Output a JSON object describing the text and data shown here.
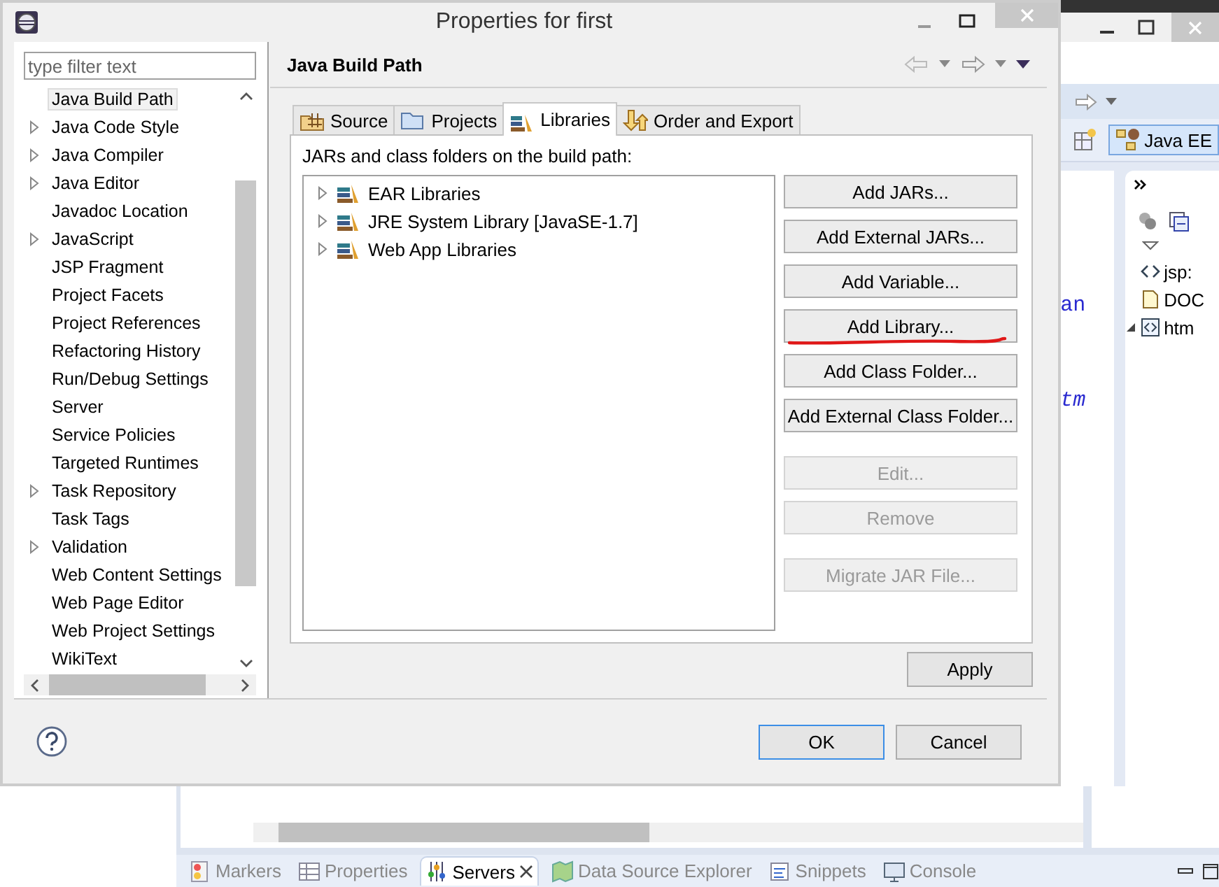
{
  "dialog": {
    "title": "Properties for first",
    "filter": {
      "placeholder": "type filter text"
    },
    "nav": [
      {
        "label": "Java Build Path",
        "expandable": false,
        "selected": true
      },
      {
        "label": "Java Code Style",
        "expandable": true,
        "selected": false
      },
      {
        "label": "Java Compiler",
        "expandable": true,
        "selected": false
      },
      {
        "label": "Java Editor",
        "expandable": true,
        "selected": false
      },
      {
        "label": "Javadoc Location",
        "expandable": false,
        "selected": false
      },
      {
        "label": "JavaScript",
        "expandable": true,
        "selected": false
      },
      {
        "label": "JSP Fragment",
        "expandable": false,
        "selected": false
      },
      {
        "label": "Project Facets",
        "expandable": false,
        "selected": false
      },
      {
        "label": "Project References",
        "expandable": false,
        "selected": false
      },
      {
        "label": "Refactoring History",
        "expandable": false,
        "selected": false
      },
      {
        "label": "Run/Debug Settings",
        "expandable": false,
        "selected": false
      },
      {
        "label": "Server",
        "expandable": false,
        "selected": false
      },
      {
        "label": "Service Policies",
        "expandable": false,
        "selected": false
      },
      {
        "label": "Targeted Runtimes",
        "expandable": false,
        "selected": false
      },
      {
        "label": "Task Repository",
        "expandable": true,
        "selected": false
      },
      {
        "label": "Task Tags",
        "expandable": false,
        "selected": false
      },
      {
        "label": "Validation",
        "expandable": true,
        "selected": false
      },
      {
        "label": "Web Content Settings",
        "expandable": false,
        "selected": false
      },
      {
        "label": "Web Page Editor",
        "expandable": false,
        "selected": false
      },
      {
        "label": "Web Project Settings",
        "expandable": false,
        "selected": false
      },
      {
        "label": "WikiText",
        "expandable": false,
        "selected": false
      }
    ],
    "page_title": "Java Build Path",
    "tabs": [
      {
        "label": "Source",
        "kind": "source",
        "selected": false
      },
      {
        "label": "Projects",
        "kind": "projects",
        "selected": false
      },
      {
        "label": "Libraries",
        "kind": "libraries",
        "selected": true
      },
      {
        "label": "Order and Export",
        "kind": "order",
        "selected": false
      }
    ],
    "description": "JARs and class folders on the build path:",
    "libraries": [
      "EAR Libraries",
      "JRE System Library [JavaSE-1.7]",
      "Web App Libraries"
    ],
    "button_groups": [
      [
        {
          "label": "Add JARs...",
          "disabled": false,
          "marked": false
        },
        {
          "label": "Add External JARs...",
          "disabled": false,
          "marked": false
        },
        {
          "label": "Add Variable...",
          "disabled": false,
          "marked": false
        },
        {
          "label": "Add Library...",
          "disabled": false,
          "marked": true
        },
        {
          "label": "Add Class Folder...",
          "disabled": false,
          "marked": false
        },
        {
          "label": "Add External Class Folder...",
          "disabled": false,
          "marked": false
        }
      ],
      [
        {
          "label": "Edit...",
          "disabled": true,
          "marked": false
        },
        {
          "label": "Remove",
          "disabled": true,
          "marked": false
        }
      ],
      [
        {
          "label": "Migrate JAR File...",
          "disabled": true,
          "marked": false
        }
      ]
    ],
    "apply": "Apply",
    "ok": "OK",
    "cancel": "Cancel"
  },
  "ide": {
    "perspective": "Java EE",
    "editor_fragments": [
      "an",
      "tm"
    ],
    "outline": [
      {
        "label": "jsp:",
        "kind": "tag"
      },
      {
        "label": "DOC",
        "kind": "doctype"
      },
      {
        "label": "htm",
        "kind": "element",
        "expanded": true
      }
    ],
    "bottom_tabs": [
      {
        "label": "Markers",
        "kind": "markers",
        "selected": false
      },
      {
        "label": "Properties",
        "kind": "properties",
        "selected": false
      },
      {
        "label": "Servers",
        "kind": "servers",
        "selected": true
      },
      {
        "label": "Data Source Explorer",
        "kind": "datasource",
        "selected": false
      },
      {
        "label": "Snippets",
        "kind": "snippets",
        "selected": false
      },
      {
        "label": "Console",
        "kind": "console",
        "selected": false
      }
    ]
  }
}
